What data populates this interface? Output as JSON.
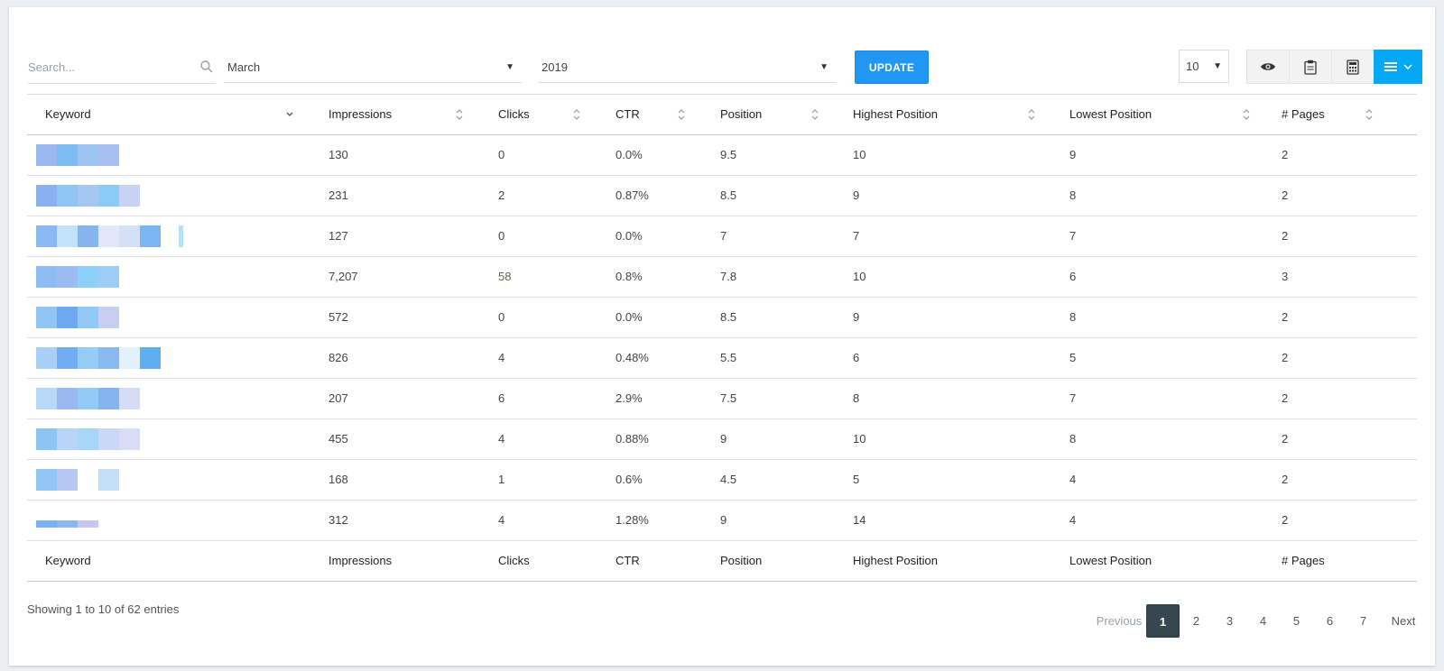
{
  "toolbar": {
    "search_placeholder": "Search...",
    "search_icon": "search-icon",
    "month": "March",
    "year": "2019",
    "update_label": "UPDATE",
    "page_length": "10",
    "icons": [
      "eye-icon",
      "clipboard-icon",
      "calculator-icon",
      "menu-icon"
    ],
    "accent": "#2196f3"
  },
  "table": {
    "columns": [
      "Keyword",
      "Impressions",
      "Clicks",
      "CTR",
      "Position",
      "Highest Position",
      "Lowest Position",
      "# Pages"
    ],
    "rows": [
      {
        "impressions": "130",
        "clicks": "0",
        "ctr": "0.0%",
        "position": "9.5",
        "highest": "10",
        "lowest": "9",
        "pages": "2"
      },
      {
        "impressions": "231",
        "clicks": "2",
        "ctr": "0.87%",
        "position": "8.5",
        "highest": "9",
        "lowest": "8",
        "pages": "2"
      },
      {
        "impressions": "127",
        "clicks": "0",
        "ctr": "0.0%",
        "position": "7",
        "highest": "7",
        "lowest": "7",
        "pages": "2"
      },
      {
        "impressions": "7,207",
        "clicks": "58",
        "ctr": "0.8%",
        "position": "7.8",
        "highest": "10",
        "lowest": "6",
        "pages": "3"
      },
      {
        "impressions": "572",
        "clicks": "0",
        "ctr": "0.0%",
        "position": "8.5",
        "highest": "9",
        "lowest": "8",
        "pages": "2"
      },
      {
        "impressions": "826",
        "clicks": "4",
        "ctr": "0.48%",
        "position": "5.5",
        "highest": "6",
        "lowest": "5",
        "pages": "2"
      },
      {
        "impressions": "207",
        "clicks": "6",
        "ctr": "2.9%",
        "position": "7.5",
        "highest": "8",
        "lowest": "7",
        "pages": "2"
      },
      {
        "impressions": "455",
        "clicks": "4",
        "ctr": "0.88%",
        "position": "9",
        "highest": "10",
        "lowest": "8",
        "pages": "2"
      },
      {
        "impressions": "168",
        "clicks": "1",
        "ctr": "0.6%",
        "position": "4.5",
        "highest": "5",
        "lowest": "4",
        "pages": "2"
      },
      {
        "impressions": "312",
        "clicks": "4",
        "ctr": "1.28%",
        "position": "9",
        "highest": "14",
        "lowest": "4",
        "pages": "2"
      }
    ]
  },
  "footer": {
    "info": "Showing 1 to 10 of 62 entries",
    "previous": "Previous",
    "next": "Next",
    "pages": [
      "1",
      "2",
      "3",
      "4",
      "5",
      "6",
      "7"
    ],
    "active_page": "1"
  }
}
